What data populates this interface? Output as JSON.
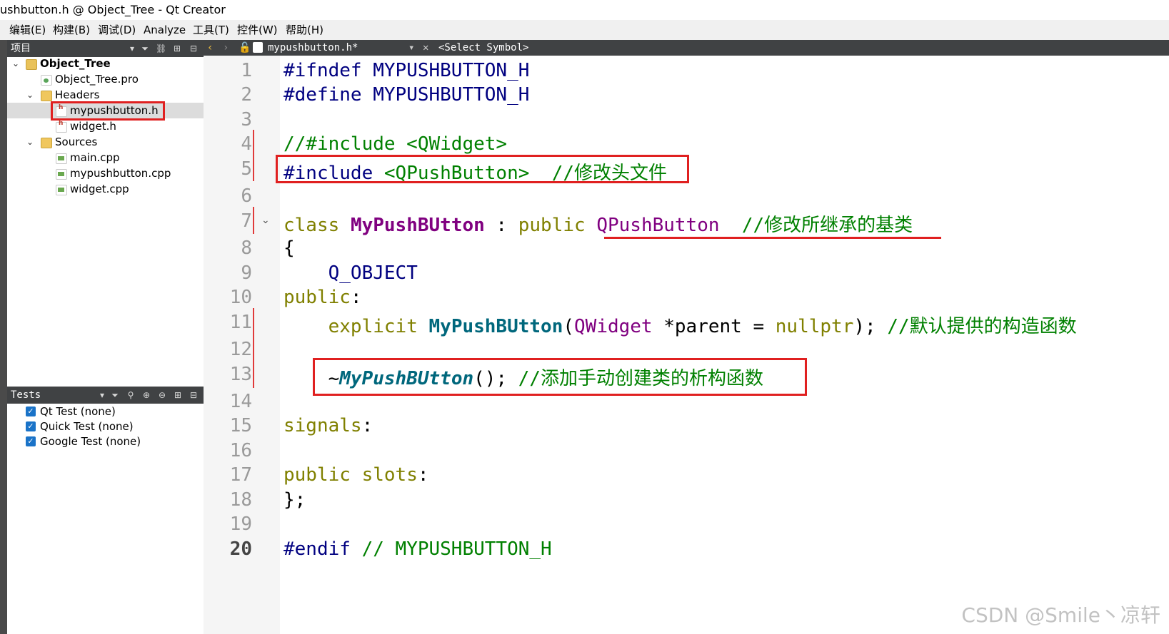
{
  "window": {
    "title": "ushbutton.h @ Object_Tree - Qt Creator"
  },
  "menu": [
    "编辑(E)",
    "构建(B)",
    "调试(D)",
    "Analyze",
    "工具(T)",
    "控件(W)",
    "帮助(H)"
  ],
  "projects_panel": {
    "title": "项目",
    "tree": {
      "root": "Object_Tree",
      "pro_file": "Object_Tree.pro",
      "headers_label": "Headers",
      "headers": [
        "mypushbutton.h",
        "widget.h"
      ],
      "sources_label": "Sources",
      "sources": [
        "main.cpp",
        "mypushbutton.cpp",
        "widget.cpp"
      ]
    },
    "selected": "mypushbutton.h"
  },
  "tests_panel": {
    "title": "Tests",
    "items": [
      {
        "label": "Qt Test (none)",
        "checked": true
      },
      {
        "label": "Quick Test (none)",
        "checked": true
      },
      {
        "label": "Google Test (none)",
        "checked": true
      }
    ]
  },
  "editor": {
    "open_file": "mypushbutton.h*",
    "symbol_selector": "<Select Symbol>",
    "current_line": "20",
    "lines": {
      "l1": {
        "num": "1",
        "pre": "#ifndef",
        "rest": " MYPUSHBUTTON_H"
      },
      "l2": {
        "num": "2",
        "pre": "#define",
        "rest": " MYPUSHBUTTON_H"
      },
      "l3": {
        "num": "3"
      },
      "l4": {
        "num": "4",
        "comment": "//#include <QWidget>"
      },
      "l5": {
        "num": "5",
        "pre": "#include",
        "inc": " <QPushButton>",
        "comment": "  //修改头文件"
      },
      "l6": {
        "num": "6"
      },
      "l7": {
        "num": "7",
        "kw": "class",
        "cls": "MyPushBUtton",
        "colon": " : ",
        "kw2": "public",
        "base": "QPushButton",
        "comment": "  //修改所继承的基类"
      },
      "l8": {
        "num": "8",
        "text": "{"
      },
      "l9": {
        "num": "9",
        "macro": "Q_OBJECT"
      },
      "l10": {
        "num": "10",
        "kw": "public",
        "text": ":"
      },
      "l11": {
        "num": "11",
        "kw": "explicit",
        "fn": "MyPushBUtton",
        "p1": "(",
        "type": "QWidget",
        "p2": " *parent = ",
        "kw2": "nullptr",
        "p3": ");",
        "comment": " //默认提供的构造函数"
      },
      "l12": {
        "num": "12"
      },
      "l13": {
        "num": "13",
        "tilde": "~",
        "fn": "MyPushBUtton",
        "p1": "();",
        "comment": " //添加手动创建类的析构函数"
      },
      "l14": {
        "num": "14"
      },
      "l15": {
        "num": "15",
        "kw": "signals",
        "text": ":"
      },
      "l16": {
        "num": "16"
      },
      "l17": {
        "num": "17",
        "kw": "public",
        "kw2": " slots",
        "text": ":"
      },
      "l18": {
        "num": "18",
        "text": "};"
      },
      "l19": {
        "num": "19"
      },
      "l20": {
        "num": "20",
        "pre": "#endif",
        "comment": " // MYPUSHBUTTON_H"
      }
    }
  },
  "watermark": "CSDN @Smile丶凉轩",
  "colors": {
    "annotation_red": "#e02020",
    "comment_green": "#008000",
    "keyword_olive": "#808000",
    "type_purple": "#800080",
    "preprocessor_navy": "#000080",
    "function_teal": "#00677c",
    "panel_dark": "#404244"
  }
}
